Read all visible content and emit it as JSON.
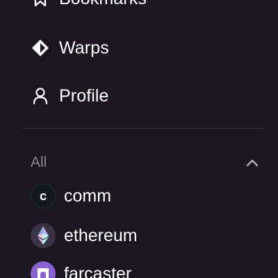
{
  "nav": {
    "items": [
      {
        "label": "Bookmarks",
        "icon": "bookmark-icon"
      },
      {
        "label": "Warps",
        "icon": "warps-diamond-icon"
      },
      {
        "label": "Profile",
        "icon": "user-icon"
      }
    ]
  },
  "channels": {
    "section_title": "All",
    "collapse_icon": "chevron-up-icon",
    "items": [
      {
        "name": "comm",
        "avatar_letter": "c",
        "icon": "comm-avatar"
      },
      {
        "name": "ethereum",
        "icon": "ethereum-logo-icon"
      },
      {
        "name": "farcaster",
        "icon": "farcaster-logo-icon"
      }
    ]
  },
  "colors": {
    "background": "#1c1622",
    "divider": "#3b3441",
    "muted_text": "#8f8896",
    "farcaster_purple": "#8a63d2"
  }
}
